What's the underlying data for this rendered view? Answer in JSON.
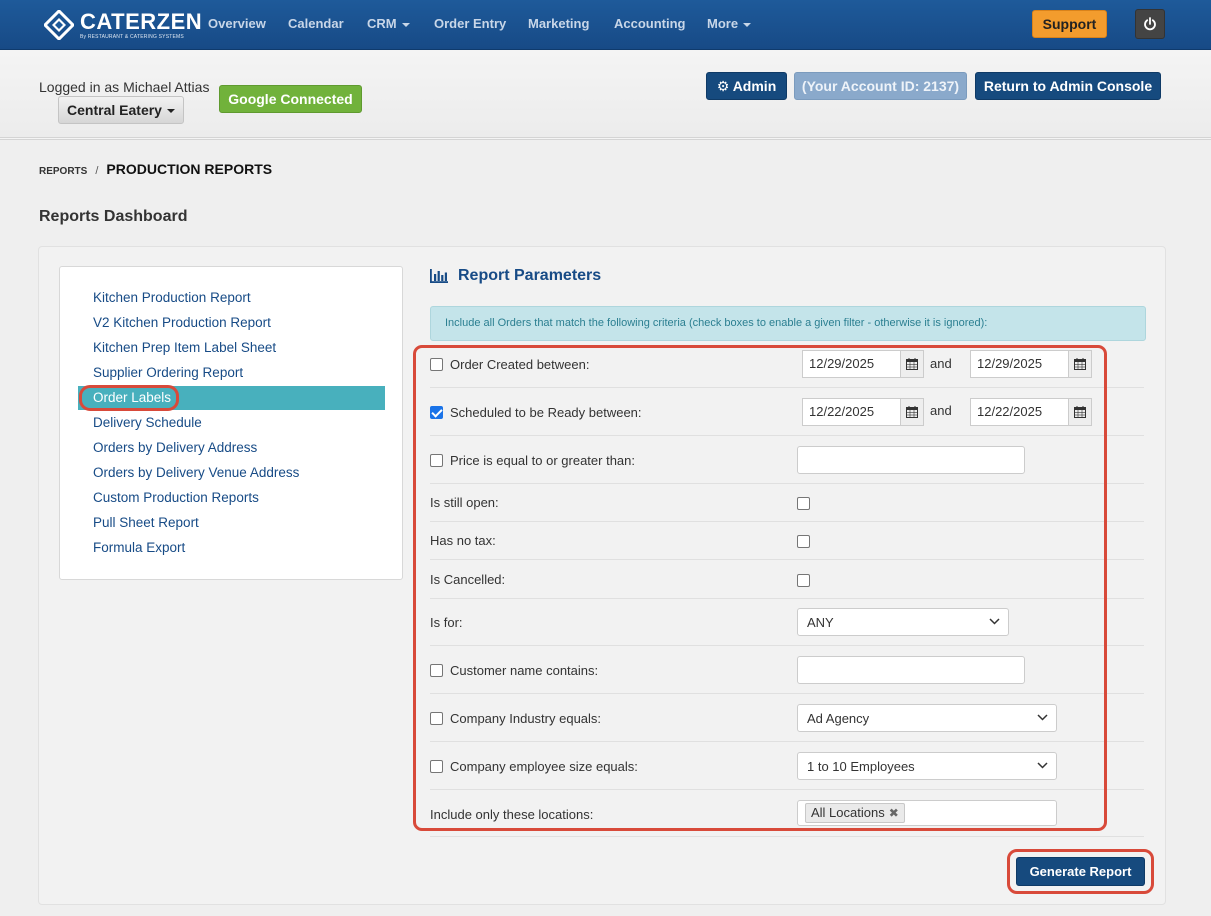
{
  "brand": {
    "name": "CATERZEN",
    "tagline": "By RESTAURANT & CATERING SYSTEMS"
  },
  "nav": {
    "items": [
      {
        "label": "Overview"
      },
      {
        "label": "Calendar"
      },
      {
        "label": "CRM"
      },
      {
        "label": "Order Entry"
      },
      {
        "label": "Marketing"
      },
      {
        "label": "Accounting"
      },
      {
        "label": "More"
      }
    ],
    "support_label": "Support"
  },
  "account": {
    "logged_in_text": "Logged in as Michael Attias",
    "location_label": "Central Eatery",
    "google_label": "Google Connected",
    "admin_label": "Admin",
    "account_id_label": "(Your Account ID: 2137)",
    "return_label": "Return to Admin Console"
  },
  "breadcrumb": {
    "parent": "REPORTS",
    "separator": "/",
    "current": "PRODUCTION REPORTS"
  },
  "page_title": "Reports Dashboard",
  "sidebar": {
    "items": [
      {
        "label": "Kitchen Production Report"
      },
      {
        "label": "V2 Kitchen Production Report"
      },
      {
        "label": "Kitchen Prep Item Label Sheet"
      },
      {
        "label": "Supplier Ordering Report"
      },
      {
        "label": "Order Labels"
      },
      {
        "label": "Delivery Schedule"
      },
      {
        "label": "Orders by Delivery Address"
      },
      {
        "label": "Orders by Delivery Venue Address"
      },
      {
        "label": "Custom Production Reports"
      },
      {
        "label": "Pull Sheet Report"
      },
      {
        "label": "Formula Export"
      }
    ],
    "active_item": "Order Labels"
  },
  "params": {
    "title": "Report Parameters",
    "info": "Include all Orders that match the following criteria (check boxes to enable a given filter - otherwise it is ignored):",
    "order_created": {
      "label": "Order Created between:",
      "checked": false,
      "from": "12/29/2025",
      "and": "and",
      "to": "12/29/2025"
    },
    "scheduled_ready": {
      "label": "Scheduled to be Ready between:",
      "checked": true,
      "from": "12/22/2025",
      "and": "and",
      "to": "12/22/2025"
    },
    "price": {
      "label": "Price is equal to or greater than:",
      "checked": false,
      "value": ""
    },
    "still_open": {
      "label": "Is still open:",
      "checked": false
    },
    "no_tax": {
      "label": "Has no tax:",
      "checked": false
    },
    "cancelled": {
      "label": "Is Cancelled:",
      "checked": false
    },
    "is_for": {
      "label": "Is for:",
      "value": "ANY"
    },
    "customer_name": {
      "label": "Customer name contains:",
      "checked": false,
      "value": ""
    },
    "industry": {
      "label": "Company Industry equals:",
      "checked": false,
      "value": "Ad Agency"
    },
    "employee_size": {
      "label": "Company employee size equals:",
      "checked": false,
      "value": "1 to 10 Employees"
    },
    "locations": {
      "label": "Include only these locations:",
      "tag": "All Locations"
    },
    "generate_label": "Generate Report"
  },
  "colors": {
    "nav_bg": "#1e5a9a",
    "primary": "#164a7e",
    "support": "#f39c2d",
    "google": "#71b23b",
    "active_item": "#48b0bd",
    "highlight": "#d84a3a",
    "info_bg": "#c4e4ea"
  }
}
